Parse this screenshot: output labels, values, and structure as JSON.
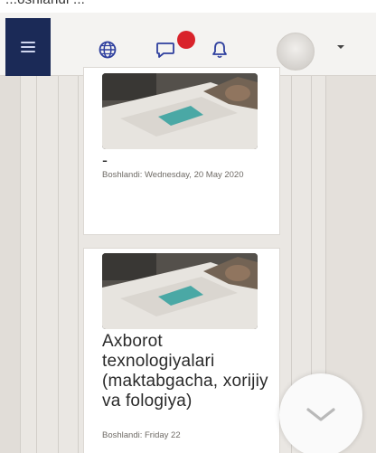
{
  "top_strip": {
    "text": "...oshlandi ..."
  },
  "navbar": {
    "menu_icon": "hamburger-icon",
    "language_icon": "globe-icon",
    "messages_icon": "chat-bubble-icon",
    "notifications_icon": "bell-icon",
    "user_menu_icon": "caret-down-icon",
    "colors": {
      "menu_bg": "#1b2a57",
      "icon": "#2e3f9e",
      "badge": "#d9232b"
    }
  },
  "courses": [
    {
      "title": "-",
      "meta": "Boshlandi: Wednesday, 20 May 2020"
    },
    {
      "title": "Axborot texnologiyalari (maktabgacha, xorijiy va fologiya)",
      "meta": "Boshlandi: Friday 22"
    }
  ],
  "scroll_down_icon": "chevron-down-icon"
}
